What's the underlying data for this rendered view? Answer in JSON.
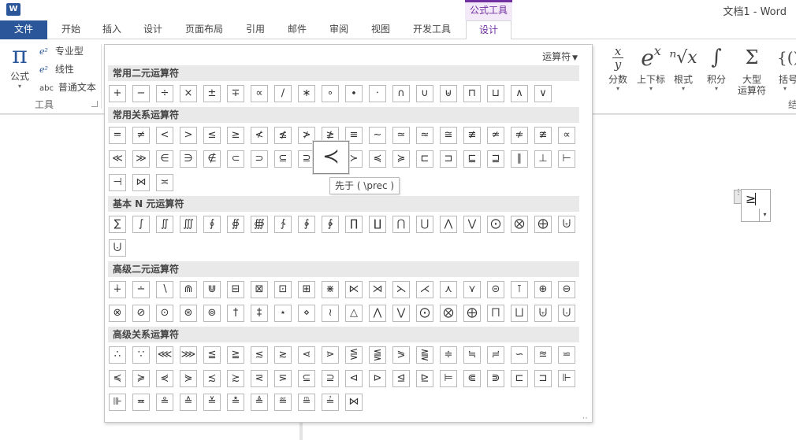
{
  "window": {
    "app_icon": "W",
    "title": "文档1 - Word",
    "context_tab_header": "公式工具"
  },
  "tabs": [
    "文件",
    "开始",
    "插入",
    "设计",
    "页面布局",
    "引用",
    "邮件",
    "审阅",
    "视图",
    "开发工具",
    "设计"
  ],
  "ribbon": {
    "equation_label": "公式",
    "equation_glyph": "π",
    "tool_items": [
      "专业型",
      "线性",
      "普通文本"
    ],
    "tool_item_icons": [
      "e²",
      "e²",
      "abc"
    ],
    "tools_group": "工具",
    "structures": [
      {
        "label": "分数",
        "glyph": "fraction"
      },
      {
        "label": "上下标",
        "glyph": "e^x"
      },
      {
        "label": "根式",
        "glyph": "ⁿ√x"
      },
      {
        "label": "积分",
        "glyph": "∫"
      },
      {
        "label": "大型运算符",
        "line1": "大型",
        "line2": "运算符",
        "glyph": "Σ"
      },
      {
        "label": "括号",
        "glyph": "{()}"
      }
    ],
    "structure_groups_edge_text": "结"
  },
  "gallery": {
    "menu_label": "运算符",
    "sections": [
      {
        "title": "常用二元运算符",
        "rows": [
          [
            "+",
            "−",
            "÷",
            "×",
            "±",
            "∓",
            "∝",
            "∕",
            "∗",
            "∘",
            "∙",
            "⋅",
            "∩",
            "∪",
            "⊎",
            "⊓",
            "⊔",
            "∧",
            "∨"
          ]
        ]
      },
      {
        "title": "常用关系运算符",
        "rows": [
          [
            "=",
            "≠",
            "<",
            ">",
            "≤",
            "≥",
            "≮",
            "≰",
            "≯",
            "≱",
            "≡",
            "∼",
            "≃",
            "≈",
            "≅",
            "≢",
            "≄",
            "≉",
            "≇",
            "∝"
          ],
          [
            "≪",
            "≫",
            "∈",
            "∋",
            "∉",
            "⊂",
            "⊃",
            "⊆",
            "⊇",
            "≺",
            "≻",
            "≼",
            "≽",
            "⊏",
            "⊐",
            "⊑",
            "⊒",
            "∥",
            "⊥",
            "⊢"
          ],
          [
            "⊣",
            "⋈",
            "≍"
          ]
        ]
      },
      {
        "title": "基本 N 元运算符",
        "rows": [
          [
            "∑",
            "∫",
            "∬",
            "∭",
            "∮",
            "∯",
            "∰",
            "∱",
            "∲",
            "∳",
            "∏",
            "∐",
            "⋂",
            "⋃",
            "⋀",
            "⋁",
            "⨀",
            "⨂",
            "⨁",
            "⨄"
          ],
          [
            "⨃"
          ]
        ]
      },
      {
        "title": "高级二元运算符",
        "rows": [
          [
            "∔",
            "∸",
            "∖",
            "⋒",
            "⋓",
            "⊟",
            "⊠",
            "⊡",
            "⊞",
            "⋇",
            "⋉",
            "⋊",
            "⋋",
            "⋌",
            "⋏",
            "⋎",
            "⊝",
            "⊺",
            "⊕",
            "⊖"
          ],
          [
            "⊗",
            "⊘",
            "⊙",
            "⊛",
            "⊚",
            "†",
            "‡",
            "⋆",
            "⋄",
            "≀",
            "△",
            "⋀",
            "⋁",
            "⨀",
            "⨂",
            "⨁",
            "⨅",
            "⨆",
            "⨄",
            "⨃"
          ]
        ]
      },
      {
        "title": "高级关系运算符",
        "rows": [
          [
            "∴",
            "∵",
            "⋘",
            "⋙",
            "≦",
            "≧",
            "≲",
            "≳",
            "⋖",
            "⋗",
            "⋚",
            "⪋",
            "⪖",
            "⪌",
            "≑",
            "≒",
            "≓",
            "∽",
            "≊",
            "⋍"
          ],
          [
            "≼",
            "≽",
            "⋞",
            "⋟",
            "≾",
            "≿",
            "⋜",
            "⋝",
            "⊆",
            "⊇",
            "⊲",
            "⊳",
            "⊴",
            "⊵",
            "⊨",
            "⋐",
            "⋑",
            "⊏",
            "⊐",
            "⊩"
          ],
          [
            "⊪",
            "≖",
            "≗",
            "≙",
            "≚",
            "≛",
            "≜",
            "≝",
            "≞",
            "≟",
            "⋈"
          ]
        ]
      }
    ],
    "hover_symbol": "≺",
    "tooltip": "先于 ( \\prec )"
  },
  "document": {
    "equation_symbol": "≥"
  }
}
